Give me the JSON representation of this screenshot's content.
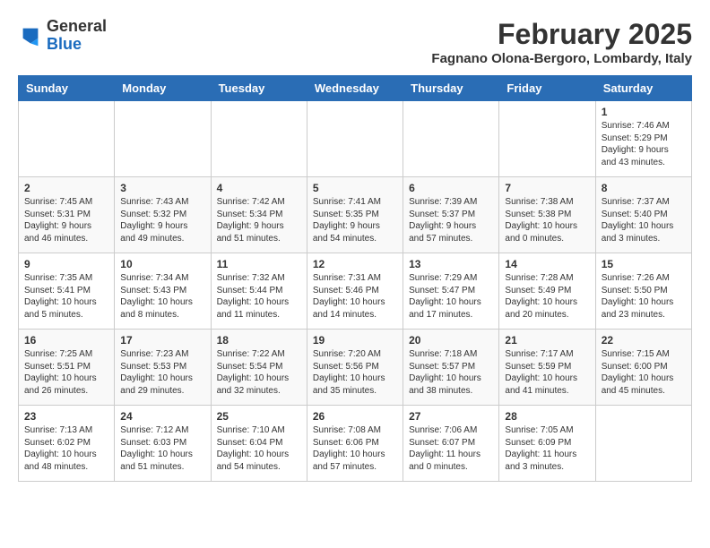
{
  "header": {
    "logo_general": "General",
    "logo_blue": "Blue",
    "month_year": "February 2025",
    "location": "Fagnano Olona-Bergoro, Lombardy, Italy"
  },
  "weekdays": [
    "Sunday",
    "Monday",
    "Tuesday",
    "Wednesday",
    "Thursday",
    "Friday",
    "Saturday"
  ],
  "weeks": [
    [
      {
        "day": "",
        "info": ""
      },
      {
        "day": "",
        "info": ""
      },
      {
        "day": "",
        "info": ""
      },
      {
        "day": "",
        "info": ""
      },
      {
        "day": "",
        "info": ""
      },
      {
        "day": "",
        "info": ""
      },
      {
        "day": "1",
        "info": "Sunrise: 7:46 AM\nSunset: 5:29 PM\nDaylight: 9 hours and 43 minutes."
      }
    ],
    [
      {
        "day": "2",
        "info": "Sunrise: 7:45 AM\nSunset: 5:31 PM\nDaylight: 9 hours and 46 minutes."
      },
      {
        "day": "3",
        "info": "Sunrise: 7:43 AM\nSunset: 5:32 PM\nDaylight: 9 hours and 49 minutes."
      },
      {
        "day": "4",
        "info": "Sunrise: 7:42 AM\nSunset: 5:34 PM\nDaylight: 9 hours and 51 minutes."
      },
      {
        "day": "5",
        "info": "Sunrise: 7:41 AM\nSunset: 5:35 PM\nDaylight: 9 hours and 54 minutes."
      },
      {
        "day": "6",
        "info": "Sunrise: 7:39 AM\nSunset: 5:37 PM\nDaylight: 9 hours and 57 minutes."
      },
      {
        "day": "7",
        "info": "Sunrise: 7:38 AM\nSunset: 5:38 PM\nDaylight: 10 hours and 0 minutes."
      },
      {
        "day": "8",
        "info": "Sunrise: 7:37 AM\nSunset: 5:40 PM\nDaylight: 10 hours and 3 minutes."
      }
    ],
    [
      {
        "day": "9",
        "info": "Sunrise: 7:35 AM\nSunset: 5:41 PM\nDaylight: 10 hours and 5 minutes."
      },
      {
        "day": "10",
        "info": "Sunrise: 7:34 AM\nSunset: 5:43 PM\nDaylight: 10 hours and 8 minutes."
      },
      {
        "day": "11",
        "info": "Sunrise: 7:32 AM\nSunset: 5:44 PM\nDaylight: 10 hours and 11 minutes."
      },
      {
        "day": "12",
        "info": "Sunrise: 7:31 AM\nSunset: 5:46 PM\nDaylight: 10 hours and 14 minutes."
      },
      {
        "day": "13",
        "info": "Sunrise: 7:29 AM\nSunset: 5:47 PM\nDaylight: 10 hours and 17 minutes."
      },
      {
        "day": "14",
        "info": "Sunrise: 7:28 AM\nSunset: 5:49 PM\nDaylight: 10 hours and 20 minutes."
      },
      {
        "day": "15",
        "info": "Sunrise: 7:26 AM\nSunset: 5:50 PM\nDaylight: 10 hours and 23 minutes."
      }
    ],
    [
      {
        "day": "16",
        "info": "Sunrise: 7:25 AM\nSunset: 5:51 PM\nDaylight: 10 hours and 26 minutes."
      },
      {
        "day": "17",
        "info": "Sunrise: 7:23 AM\nSunset: 5:53 PM\nDaylight: 10 hours and 29 minutes."
      },
      {
        "day": "18",
        "info": "Sunrise: 7:22 AM\nSunset: 5:54 PM\nDaylight: 10 hours and 32 minutes."
      },
      {
        "day": "19",
        "info": "Sunrise: 7:20 AM\nSunset: 5:56 PM\nDaylight: 10 hours and 35 minutes."
      },
      {
        "day": "20",
        "info": "Sunrise: 7:18 AM\nSunset: 5:57 PM\nDaylight: 10 hours and 38 minutes."
      },
      {
        "day": "21",
        "info": "Sunrise: 7:17 AM\nSunset: 5:59 PM\nDaylight: 10 hours and 41 minutes."
      },
      {
        "day": "22",
        "info": "Sunrise: 7:15 AM\nSunset: 6:00 PM\nDaylight: 10 hours and 45 minutes."
      }
    ],
    [
      {
        "day": "23",
        "info": "Sunrise: 7:13 AM\nSunset: 6:02 PM\nDaylight: 10 hours and 48 minutes."
      },
      {
        "day": "24",
        "info": "Sunrise: 7:12 AM\nSunset: 6:03 PM\nDaylight: 10 hours and 51 minutes."
      },
      {
        "day": "25",
        "info": "Sunrise: 7:10 AM\nSunset: 6:04 PM\nDaylight: 10 hours and 54 minutes."
      },
      {
        "day": "26",
        "info": "Sunrise: 7:08 AM\nSunset: 6:06 PM\nDaylight: 10 hours and 57 minutes."
      },
      {
        "day": "27",
        "info": "Sunrise: 7:06 AM\nSunset: 6:07 PM\nDaylight: 11 hours and 0 minutes."
      },
      {
        "day": "28",
        "info": "Sunrise: 7:05 AM\nSunset: 6:09 PM\nDaylight: 11 hours and 3 minutes."
      },
      {
        "day": "",
        "info": ""
      }
    ]
  ]
}
